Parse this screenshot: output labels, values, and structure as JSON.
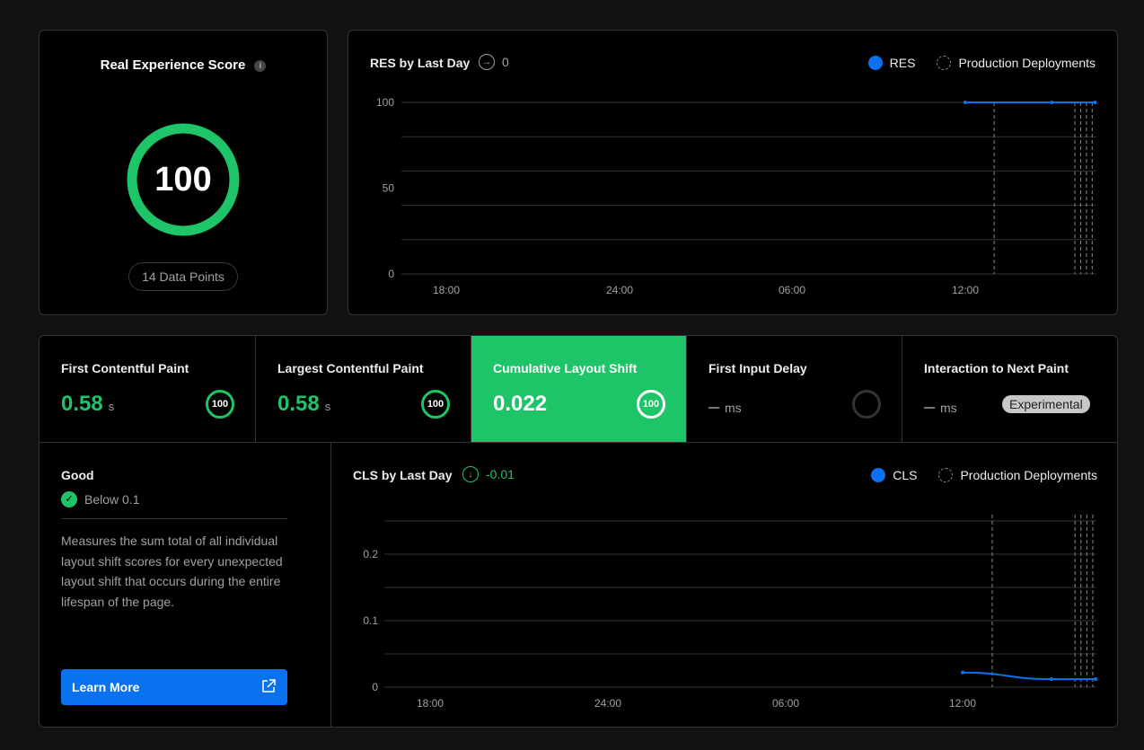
{
  "score_card": {
    "title": "Real Experience Score",
    "info_icon": "i",
    "score": "100",
    "data_points": "14 Data Points",
    "ring_color": "#1ec468"
  },
  "res_chart": {
    "title": "RES by Last Day",
    "delta_icon": "→",
    "delta": "0",
    "legend_series": "RES",
    "legend_deploys": "Production Deployments",
    "chart_data": {
      "type": "line",
      "title": "RES by Last Day",
      "y_ticks": [
        "100",
        "50",
        "0"
      ],
      "x_ticks": [
        "18:00",
        "24:00",
        "06:00",
        "12:00"
      ],
      "ylim": [
        0,
        100
      ],
      "series": [
        {
          "name": "RES",
          "x": [
            12.0,
            15.0,
            16.5
          ],
          "values": [
            100,
            100,
            100
          ]
        }
      ],
      "deployments_x": [
        13.0,
        15.8,
        16.0,
        16.2,
        16.4
      ],
      "xlim": [
        16.5,
        40.6
      ],
      "color": "#0a72ef"
    }
  },
  "metrics": [
    {
      "name": "First Contentful Paint",
      "value": "0.58",
      "unit": "s",
      "badge": "100"
    },
    {
      "name": "Largest Contentful Paint",
      "value": "0.58",
      "unit": "s",
      "badge": "100"
    },
    {
      "name": "Cumulative Layout Shift",
      "value": "0.022",
      "unit": "",
      "badge": "100"
    },
    {
      "name": "First Input Delay",
      "unit": "ms"
    },
    {
      "name": "Interaction to Next Paint",
      "unit": "ms",
      "tag": "Experimental"
    }
  ],
  "detail": {
    "rating": "Good",
    "threshold": "Below 0.1",
    "check_icon": "✓",
    "description": "Measures the sum total of all individual layout shift scores for every unexpected layout shift that occurs during the entire lifespan of the page.",
    "learn_more": "Learn More"
  },
  "cls_chart": {
    "title": "CLS by Last Day",
    "delta_icon": "↓",
    "delta": "-0.01",
    "delta_color": "#1ec468",
    "legend_series": "CLS",
    "legend_deploys": "Production Deployments",
    "chart_data": {
      "type": "line",
      "title": "CLS by Last Day",
      "y_ticks": [
        "0.2",
        "0.1",
        "0"
      ],
      "x_ticks": [
        "18:00",
        "24:00",
        "06:00",
        "12:00"
      ],
      "ylim": [
        0,
        0.25
      ],
      "series": [
        {
          "name": "CLS",
          "x": [
            12.0,
            15.0,
            16.5
          ],
          "values": [
            0.022,
            0.012,
            0.012
          ]
        }
      ],
      "deployments_x": [
        13.0,
        15.8,
        16.0,
        16.2,
        16.4
      ],
      "color": "#0a72ef"
    }
  }
}
